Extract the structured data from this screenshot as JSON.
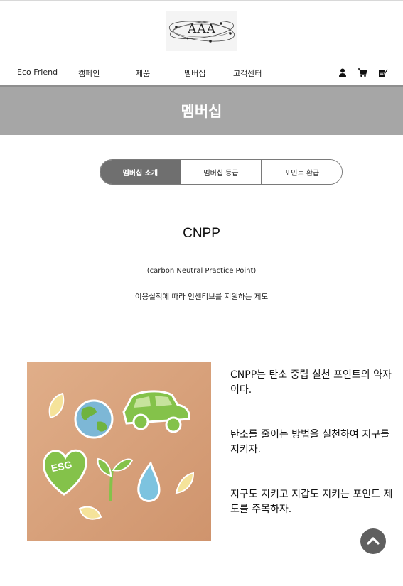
{
  "header": {
    "logo_text": "AAA",
    "nav": {
      "brand": "Eco Friend",
      "items": [
        "캠페인",
        "제품",
        "멤버십",
        "고객센터"
      ],
      "icons": [
        "user-icon",
        "cart-icon",
        "edit-icon"
      ]
    }
  },
  "banner": {
    "title": "멤버십"
  },
  "tabs": [
    {
      "label": "멤버십 소개",
      "active": true
    },
    {
      "label": "멤버십 등급",
      "active": false
    },
    {
      "label": "포인트 환급",
      "active": false
    }
  ],
  "intro": {
    "title": "CNPP",
    "subtitle": "(carbon Neutral Practice Point)",
    "description": "이용실적에 따라 인센티브를 지원하는 제도"
  },
  "content": {
    "image_label": "ESG",
    "paragraphs": [
      "CNPP는 탄소 중립 실천 포인트의 약자이다.",
      "탄소를 줄이는 방법을 실천하여 지구를 지키자.",
      "지구도 지키고 지갑도 지키는 포인트 제도를 주목하자."
    ]
  },
  "colors": {
    "banner_bg": "#a6a6a6",
    "active_tab": "#6f6f6f",
    "photo_bg": "#d9a47f",
    "leaf_green": "#7cbd42"
  }
}
